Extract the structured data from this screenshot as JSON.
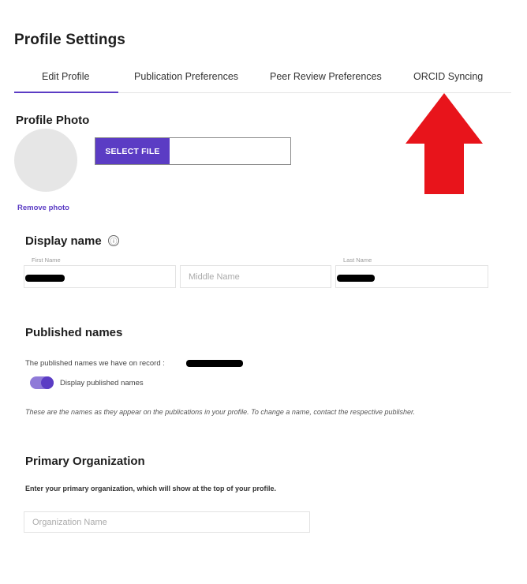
{
  "page": {
    "title": "Profile Settings"
  },
  "tabs": [
    {
      "label": "Edit Profile",
      "active": true
    },
    {
      "label": "Publication Preferences",
      "active": false
    },
    {
      "label": "Peer Review Preferences",
      "active": false
    },
    {
      "label": "ORCID Syncing",
      "active": false
    }
  ],
  "photo": {
    "title": "Profile Photo",
    "select_label": "SELECT FILE",
    "remove_label": "Remove photo"
  },
  "display_name": {
    "title": "Display name",
    "info_glyph": "ⓘ",
    "first_label": "First Name",
    "middle_placeholder": "Middle Name",
    "last_label": "Last Name"
  },
  "published_names": {
    "title": "Published names",
    "record_text": "The published names we have on record :",
    "toggle_label": "Display published names",
    "toggle_on": true,
    "note": "These are the names as they appear on the publications in your profile. To change a name, contact the respective publisher."
  },
  "organization": {
    "title": "Primary Organization",
    "description": "Enter your primary organization, which will show at the top of your profile.",
    "placeholder": "Organization Name"
  },
  "colors": {
    "accent": "#5b3cc4",
    "toggle_track": "#8f7ad8",
    "arrow": "#e8141b",
    "avatar": "#e6e6e6"
  }
}
